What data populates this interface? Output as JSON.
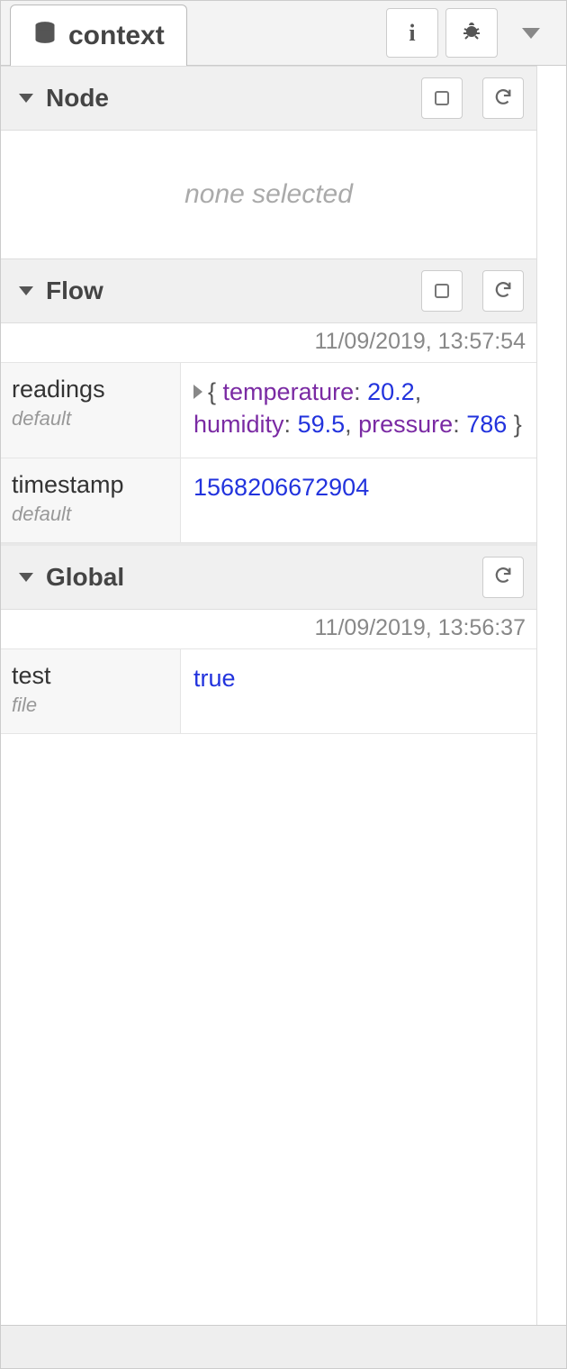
{
  "tab": {
    "label": "context"
  },
  "sections": {
    "node": {
      "title": "Node",
      "empty_msg": "none selected"
    },
    "flow": {
      "title": "Flow",
      "timestamp": "11/09/2019, 13:57:54",
      "rows": [
        {
          "key": "readings",
          "store": "default",
          "type": "object",
          "obj": {
            "temperature": 20.2,
            "humidity": 59.5,
            "pressure": 786
          }
        },
        {
          "key": "timestamp",
          "store": "default",
          "type": "number",
          "value": 1568206672904
        }
      ]
    },
    "global": {
      "title": "Global",
      "timestamp": "11/09/2019, 13:56:37",
      "rows": [
        {
          "key": "test",
          "store": "file",
          "type": "boolean",
          "value": true
        }
      ]
    }
  }
}
